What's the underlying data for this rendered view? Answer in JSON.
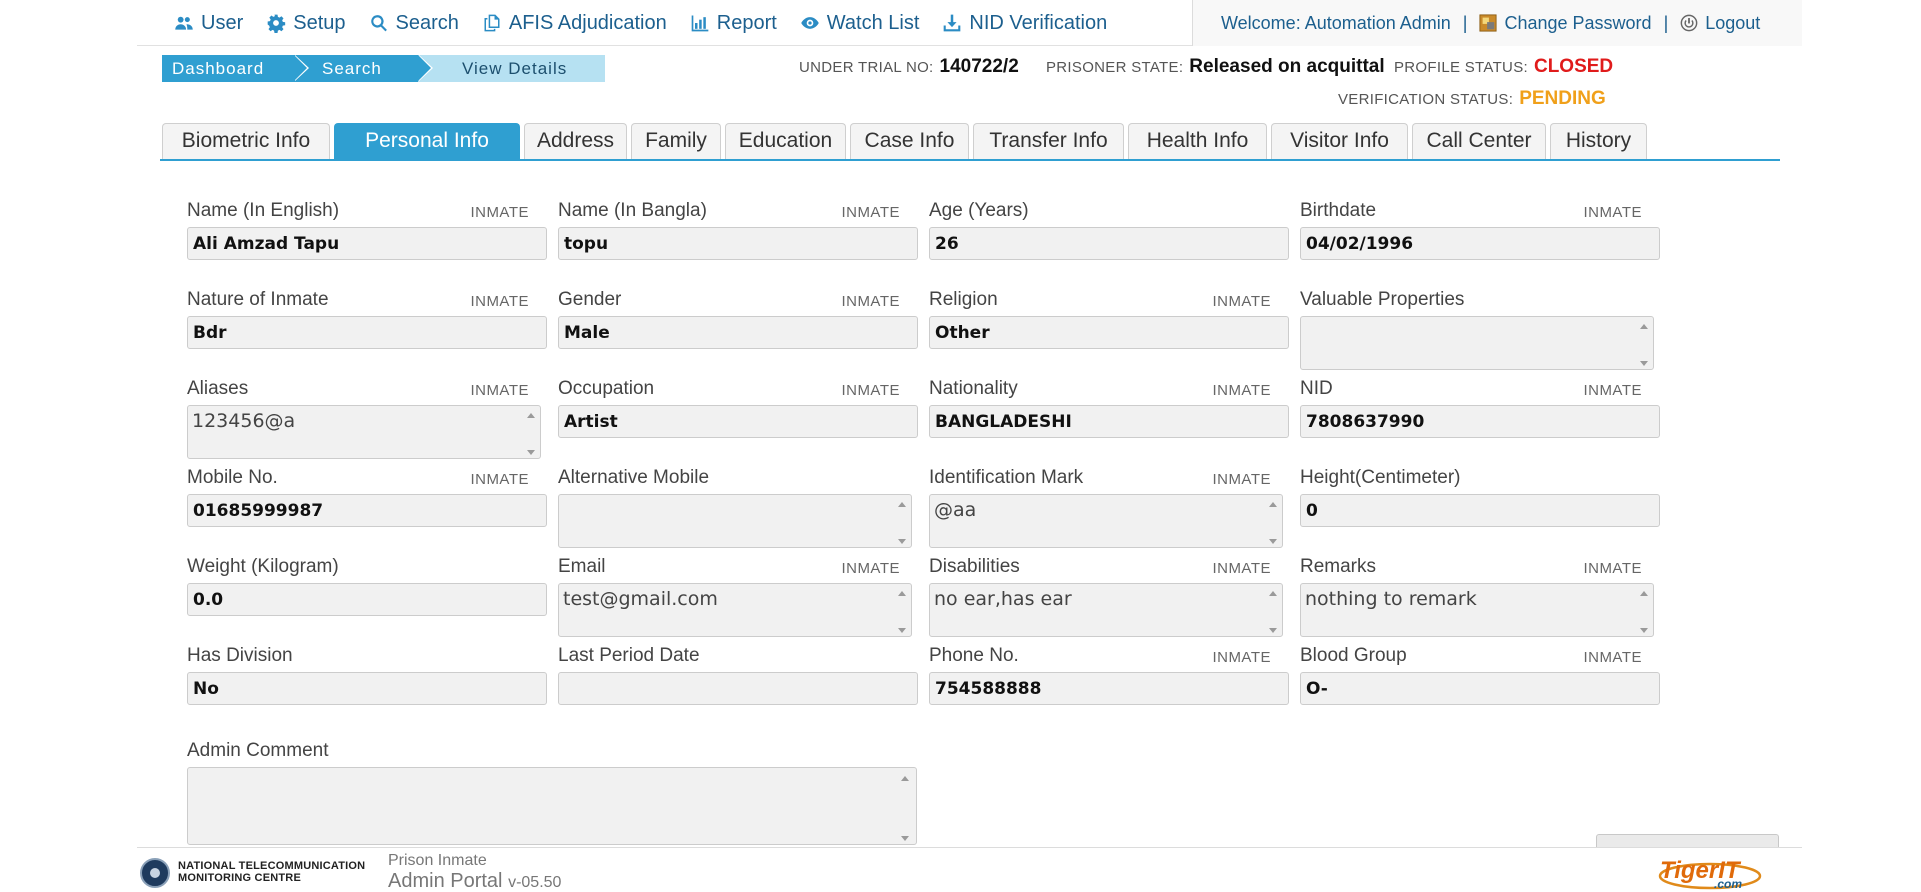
{
  "nav": {
    "items": [
      {
        "label": "User",
        "icon": "users-icon"
      },
      {
        "label": "Setup",
        "icon": "gear-icon"
      },
      {
        "label": "Search",
        "icon": "search-icon"
      },
      {
        "label": "AFIS Adjudication",
        "icon": "copy-icon"
      },
      {
        "label": "Report",
        "icon": "bar-chart-icon"
      },
      {
        "label": "Watch List",
        "icon": "eye-icon"
      },
      {
        "label": "NID Verification",
        "icon": "download-icon"
      }
    ],
    "welcome": "Welcome: Automation Admin",
    "separator": "|",
    "change_password": "Change Password",
    "logout": "Logout"
  },
  "breadcrumb": [
    "Dashboard",
    "Search",
    "View Details"
  ],
  "status": {
    "under_trial_label": "UNDER TRIAL NO:",
    "under_trial_value": "140722/2",
    "prisoner_state_label": "PRISONER STATE:",
    "prisoner_state_value": "Released on acquittal",
    "profile_status_label": "PROFILE STATUS:",
    "profile_status_value": "CLOSED",
    "verification_status_label": "VERIFICATION STATUS:",
    "verification_status_value": "PENDING"
  },
  "tabs": [
    "Biometric Info",
    "Personal Info",
    "Address",
    "Family",
    "Education",
    "Case Info",
    "Transfer Info",
    "Health Info",
    "Visitor Info",
    "Call Center",
    "History"
  ],
  "active_tab": "Personal Info",
  "inmate_tag": "INMATE",
  "fields": {
    "name_english": {
      "label": "Name (In English)",
      "value": "Ali Amzad Tapu"
    },
    "name_bangla": {
      "label": "Name (In Bangla)",
      "value": "topu"
    },
    "age": {
      "label": "Age (Years)",
      "value": "26"
    },
    "birthdate": {
      "label": "Birthdate",
      "value": "04/02/1996"
    },
    "nature": {
      "label": "Nature of Inmate",
      "value": "Bdr"
    },
    "gender": {
      "label": "Gender",
      "value": "Male"
    },
    "religion": {
      "label": "Religion",
      "value": "Other"
    },
    "valuables": {
      "label": "Valuable Properties",
      "value": ""
    },
    "aliases": {
      "label": "Aliases",
      "value": "123456@a"
    },
    "occupation": {
      "label": "Occupation",
      "value": "Artist"
    },
    "nationality": {
      "label": "Nationality",
      "value": "BANGLADESHI"
    },
    "nid": {
      "label": "NID",
      "value": "7808637990"
    },
    "mobile": {
      "label": "Mobile No.",
      "value": "01685999987"
    },
    "alt_mobile": {
      "label": "Alternative Mobile",
      "value": ""
    },
    "id_mark": {
      "label": "Identification Mark",
      "value": "@aa"
    },
    "height": {
      "label": "Height(Centimeter)",
      "value": "0"
    },
    "weight": {
      "label": "Weight (Kilogram)",
      "value": "0.0"
    },
    "email": {
      "label": "Email",
      "value": "test@gmail.com"
    },
    "disabilities": {
      "label": "Disabilities",
      "value": "no ear,has ear"
    },
    "remarks": {
      "label": "Remarks",
      "value": "nothing to remark"
    },
    "has_division": {
      "label": "Has Division",
      "value": "No"
    },
    "last_period": {
      "label": "Last Period Date",
      "value": ""
    },
    "phone": {
      "label": "Phone No.",
      "value": "754588888"
    },
    "blood_group": {
      "label": "Blood Group",
      "value": "O-"
    },
    "admin_comment": {
      "label": "Admin Comment",
      "value": ""
    }
  },
  "footer": {
    "org_line1": "NATIONAL TELECOMMUNICATION",
    "org_line2": "MONITORING CENTRE",
    "portal_small": "Prison Inmate",
    "portal_big": "Admin Portal",
    "version": "v-05.50",
    "vendor": "TigerIT",
    "vendor_suffix": ".com"
  },
  "colors": {
    "accent": "#2f9fd1",
    "link": "#1c5f8e",
    "closed": "#e01b1b",
    "pending": "#f0a01a"
  }
}
